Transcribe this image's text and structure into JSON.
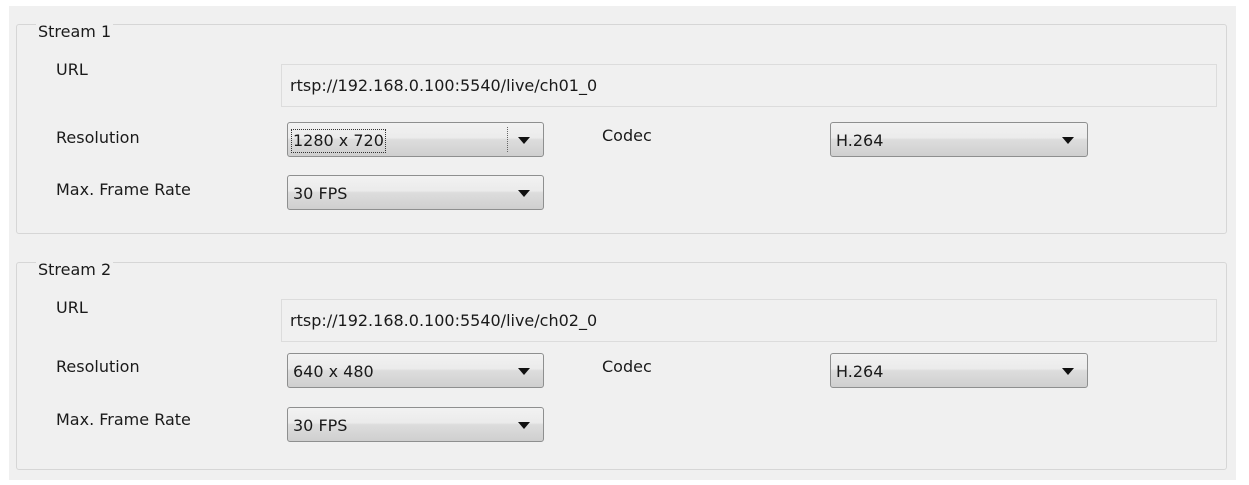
{
  "stream1": {
    "title": "Stream 1",
    "url_label": "URL",
    "url_value": "rtsp://192.168.0.100:5540/live/ch01_0",
    "resolution_label": "Resolution",
    "resolution_value": "1280 x 720",
    "codec_label": "Codec",
    "codec_value": "H.264",
    "framerate_label": "Max. Frame Rate",
    "framerate_value": "30 FPS"
  },
  "stream2": {
    "title": "Stream 2",
    "url_label": "URL",
    "url_value": "rtsp://192.168.0.100:5540/live/ch02_0",
    "resolution_label": "Resolution",
    "resolution_value": "640 x 480",
    "codec_label": "Codec",
    "codec_value": "H.264",
    "framerate_label": "Max. Frame Rate",
    "framerate_value": "30 FPS"
  },
  "colors": {
    "panel_background": "#f0f0f0",
    "group_border": "#d6d6d6",
    "combo_border": "#8e8f8f"
  }
}
